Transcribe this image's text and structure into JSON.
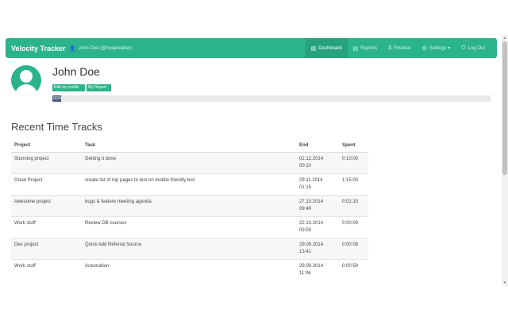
{
  "navbar": {
    "brand": "Velocity Tracker",
    "user_label": "John Doe (@heapwalker)",
    "items": [
      {
        "label": "Dashboard",
        "icon": "dashboard-icon",
        "active": true
      },
      {
        "label": "Reports",
        "icon": "reports-icon",
        "active": false
      },
      {
        "label": "Finance",
        "icon": "dollar-icon",
        "active": false
      },
      {
        "label": "Settings ▾",
        "icon": "gear-icon",
        "active": false
      },
      {
        "label": "Log Out",
        "icon": "power-icon",
        "active": false
      }
    ]
  },
  "profile": {
    "name": "John Doe",
    "edit_button": "Edit my profile",
    "report_button": "My Report",
    "progress_label": "0/24",
    "progress_fraction": 0.02
  },
  "time_tracks": {
    "title": "Recent Time Tracks",
    "headers": [
      "Project",
      "Task",
      "End",
      "Spent"
    ],
    "rows": [
      {
        "project": "Stunning project",
        "task": "Getting it done",
        "end": "02.12.2014 00:10",
        "spent": "0:10:00"
      },
      {
        "project": "Great Project",
        "task": "create list of top pages to test on mobile friendly test",
        "end": "29.11.2014 01:15",
        "spent": "1:15:00"
      },
      {
        "project": "Awesome project",
        "task": "bugs & feature meeting agenda",
        "end": "27.10.2014 09:49",
        "spent": "0:02:10"
      },
      {
        "project": "Work stuff",
        "task": "Review DB courses",
        "end": "22.10.2014 09:59",
        "spent": "0:00:09"
      },
      {
        "project": "Dev project",
        "task": "Quick Add Referral Source",
        "end": "29.09.2014 13:41",
        "spent": "0:00:08"
      },
      {
        "project": "Work stuff",
        "task": "Automation",
        "end": "29.09.2014 11:06",
        "spent": "0:00:59"
      }
    ]
  },
  "colors": {
    "accent": "#2bb38b",
    "progress": "#4a5a7a"
  }
}
